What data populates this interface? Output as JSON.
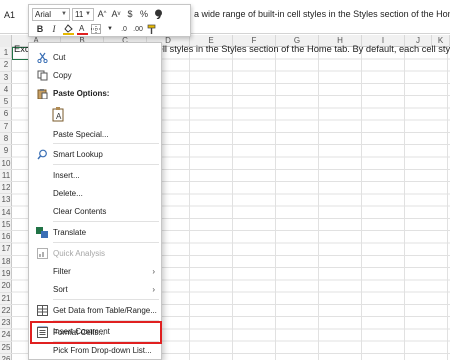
{
  "formula_bar": {
    "name_box": "A1",
    "formula_text": "a wide range of built-in cell styles in the Styles section of the Home"
  },
  "mini_toolbar": {
    "font_name": "Arial",
    "font_size": "11",
    "grow_font_icon": "A^",
    "shrink_font_icon": "Av",
    "currency_icon": "$",
    "percent_icon": "%",
    "comma_icon": "comma-style-icon",
    "bold_label": "B",
    "italic_label": "I",
    "underline_color": "#e6b800",
    "font_color": "#e02020"
  },
  "grid": {
    "columns": [
      "A",
      "B",
      "C",
      "D",
      "E",
      "F",
      "G",
      "H",
      "I",
      "J",
      "K"
    ],
    "rows": [
      "1",
      "2",
      "3",
      "4",
      "5",
      "6",
      "7",
      "8",
      "9",
      "10",
      "11",
      "12",
      "13",
      "14",
      "15",
      "16",
      "17",
      "18",
      "19",
      "20",
      "21",
      "22",
      "23",
      "24",
      "25",
      "26"
    ],
    "cell_a1": "Excel has a wide range of built-in cell styles in the Styles section of the Home tab. By default, each cell style ha",
    "active_cell_color": "#217346"
  },
  "context_menu": {
    "items": [
      {
        "label": "Cut",
        "icon": "scissors-icon"
      },
      {
        "label": "Copy",
        "icon": "copy-icon"
      },
      {
        "label": "Paste Options:",
        "icon": "paste-icon"
      },
      {
        "label": "Paste Special...",
        "icon": ""
      },
      {
        "label": "Smart Lookup",
        "icon": "search-icon"
      },
      {
        "label": "Insert...",
        "icon": ""
      },
      {
        "label": "Delete...",
        "icon": ""
      },
      {
        "label": "Clear Contents",
        "icon": ""
      },
      {
        "label": "Translate",
        "icon": "translate-icon"
      },
      {
        "label": "Quick Analysis",
        "icon": "quick-analysis-icon"
      },
      {
        "label": "Filter",
        "icon": ""
      },
      {
        "label": "Sort",
        "icon": ""
      },
      {
        "label": "Get Data from Table/Range...",
        "icon": "table-icon"
      },
      {
        "label": "Insert Comment",
        "icon": "comment-icon"
      },
      {
        "label": "Format Cells...",
        "icon": "format-cells-icon"
      },
      {
        "label": "Pick From Drop-down List...",
        "icon": ""
      }
    ],
    "highlight_color": "#e02020"
  }
}
